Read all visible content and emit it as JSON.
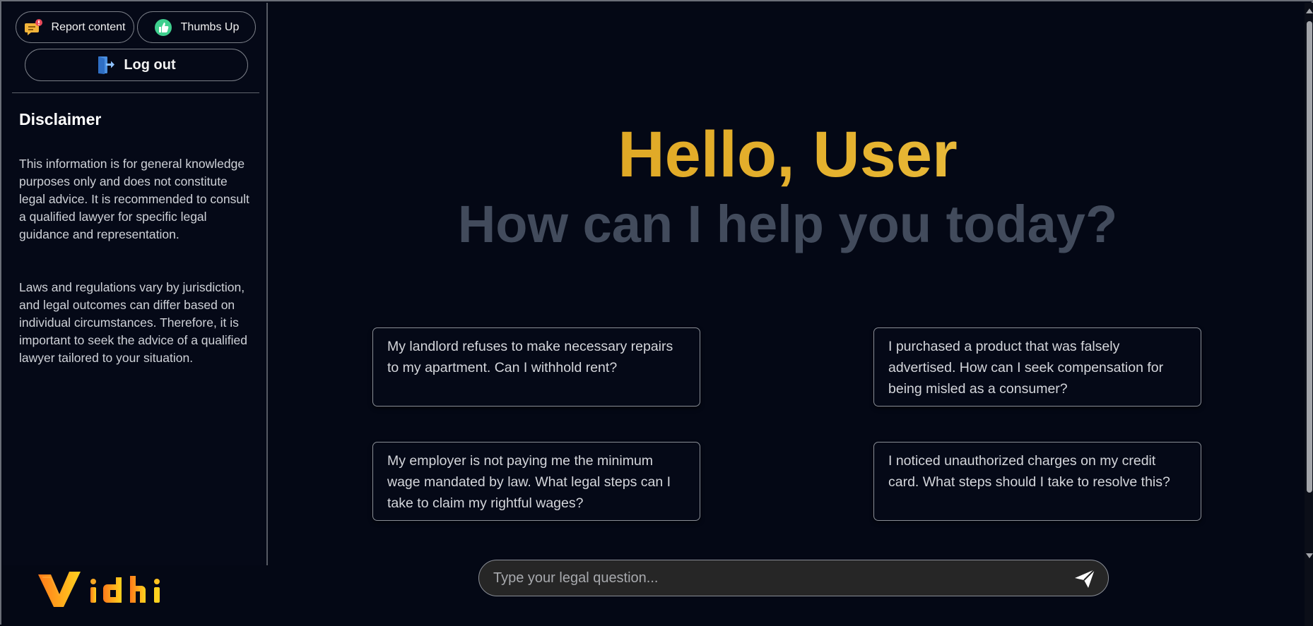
{
  "sidebar": {
    "report_label": "Report content",
    "thumbs_label": "Thumbs Up",
    "logout_label": "Log out",
    "disclaimer_title": "Disclaimer",
    "disclaimer_p1": "This information is for general knowledge purposes only and does not constitute legal advice. It is recommended to consult a qualified lawyer for specific legal guidance and representation.",
    "disclaimer_p2": "Laws and regulations vary by jurisdiction, and legal outcomes can differ based on individual circumstances. Therefore, it is important to seek the advice of a qualified lawyer tailored to your situation.",
    "logo_text": "Vidhi"
  },
  "main": {
    "greeting": "Hello, User",
    "subheading": "How can I help you today?",
    "suggestions": [
      "My landlord refuses to make necessary repairs to my apartment. Can I withhold rent?",
      "I purchased a product that was falsely advertised. How can I seek compensation for being misled as a consumer?",
      "My employer is not paying me the minimum wage mandated by law. What legal steps can I take to claim my rightful wages?",
      "I noticed unauthorized charges on my credit card. What steps should I take to resolve this?"
    ],
    "input": {
      "placeholder": "Type your legal question...",
      "value": ""
    }
  },
  "colors": {
    "background": "#040815",
    "accent_gold": "#e6b431",
    "subheading_gray": "#424b5c",
    "input_bg": "#262626"
  },
  "icons": {
    "report": "report-content-icon",
    "thumbs": "thumbs-up-icon",
    "logout": "logout-door-icon",
    "send": "send-paper-plane-icon"
  }
}
